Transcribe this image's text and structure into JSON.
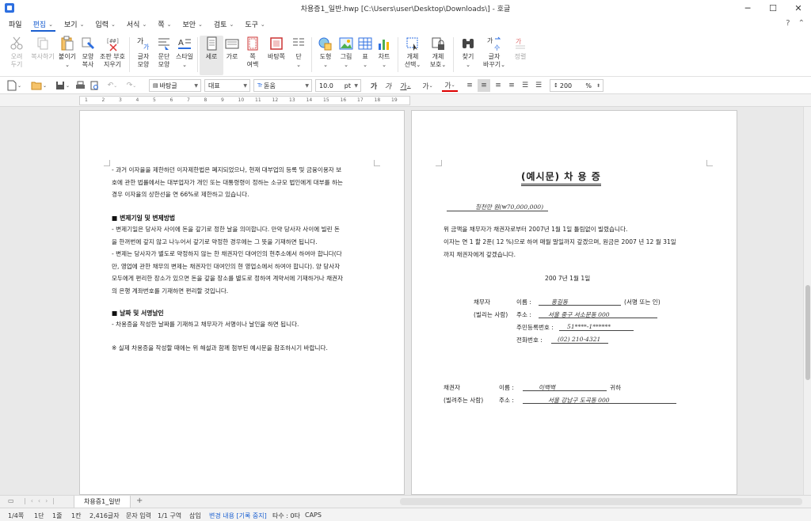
{
  "window": {
    "title": "차용증1_일반.hwp [C:\\Users\\user\\Desktop\\Downloads\\] - 호글",
    "controls": [
      "─",
      "☐",
      "✕"
    ]
  },
  "menu": [
    {
      "label": "파일",
      "caret": false
    },
    {
      "label": "편집",
      "caret": true,
      "active": true
    },
    {
      "label": "보기",
      "caret": true
    },
    {
      "label": "입력",
      "caret": true
    },
    {
      "label": "서식",
      "caret": true
    },
    {
      "label": "쪽",
      "caret": true
    },
    {
      "label": "보안",
      "caret": true
    },
    {
      "label": "검토",
      "caret": true
    },
    {
      "label": "도구",
      "caret": true
    }
  ],
  "ribbon": {
    "cut": "오려\n두기",
    "copy": "복사하기",
    "paste": "붙이기",
    "format_copy": "모양\n복사",
    "clear_format": "조판 부호\n지우기",
    "char_shape": "글자\n모양",
    "para_shape": "문단\n모양",
    "style": "스타일",
    "portrait": "세로",
    "landscape": "가로",
    "margins": "쪽\n여백",
    "page_border": "바탕쪽",
    "columns": "단",
    "shapes": "도형",
    "picture": "그림",
    "table": "표",
    "chart": "차트",
    "object_select": "개체\n선택",
    "object_protect": "개체\n보호",
    "find": "찾기",
    "replace": "글자\n바꾸기",
    "tidy": "정렬"
  },
  "format_bar": {
    "style": "바탕글",
    "lang": "대표",
    "font": "돋움",
    "size": "10.0",
    "size_unit": "pt",
    "line_spacing": "200",
    "line_spacing_unit": "%"
  },
  "ruler_numbers": [
    "1",
    "2",
    "3",
    "4",
    "5",
    "6",
    "7",
    "8",
    "9",
    "10",
    "11",
    "12",
    "13",
    "14",
    "15",
    "16",
    "17",
    "18",
    "19"
  ],
  "left_page": {
    "lines_1": [
      "- 과거 이자율을 제한하던 이자제한법은 폐지되었으나, 현재 대부업의 등록 및 금융이용자 보",
      "호에 관한 법률에서는 대부업자가 개인 또는 대통령령이 정하는 소규모 법인에게 대부를 하는",
      "경우 이자율의 상한선을 연 66%로 제한하고 있습니다."
    ],
    "head_2": "■ 변제기일 및 변제방법",
    "lines_2": [
      "- 변제기일은 당사자 사이에 돈을 갚기로 정한 날을 의미합니다. 만약 당사자 사이에 빌린 돈",
      "을 한꺼번에 갚지 않고 나누어서 갚기로 약정한 경우에는 그 뜻을 기재하면 됩니다.",
      "- 변제는 당사자가 별도로 약정하지 않는 한 채권자인 대여인의 현주소에서 하여야 합니다(다",
      "만, 영업에 관한 채무의 변제는 채권자인 대여인의 현 영업소에서 하여야 합니다). 양 당사자",
      "모두에게 편리한 장소가 있으면 돈을 갚을 장소를 별도로 정하여 계약서에 기재하거나 채권자",
      "의 은행 계좌번호를 기재하면 편리할 것입니다."
    ],
    "head_3": "■ 날짜 및 서명날인",
    "lines_3": [
      "- 차용증을 작성한 날짜를 기재하고 채무자가 서명이나 날인을 하면 됩니다."
    ],
    "note": "※ 실제 차용증을 작성할 때에는 위 해설과 함께 첨부된 예시문을 참조하시기 바랍니다."
  },
  "right_page": {
    "title": "(예시문) 차    용    증",
    "amount": "칠천만  원(₩70,000,000)",
    "body": [
      "위 금액을 채무자가 채권자로부터  2007년  1월  1일 틀림없이 빌렸습니다.",
      "이자는 연  1 할   2푼(  12 %)으로 하여 매월  말일까지 갚겠으며, 원금은  2007 년  12 월  31일",
      "까지 채권자에게 갚겠습니다."
    ],
    "date": "200 7년    1월    1일",
    "debtor": {
      "role": "채무자",
      "role_sub": "(빌리는 사람)",
      "name_label": "이름 :",
      "name_value": "홍길동",
      "name_suffix": "(서명 또는 인)",
      "addr_label": "주소 :",
      "addr_value": "서울 중구 서소문동 000",
      "id_label": "주민등록번호 :",
      "id_value": "51****-1******",
      "phone_label": "전화번호 :",
      "phone_value": "(02)  210-4321"
    },
    "creditor": {
      "role": "채권자",
      "role_sub": "(빌려주는 사람)",
      "name_label": "이름 :",
      "name_value": "이백백",
      "name_suffix": "귀하",
      "addr_label": "주소 :",
      "addr_value": "서울 강남구 도곡동 000"
    }
  },
  "tabs": {
    "doc_tab": "차용증1_일반",
    "add": "+"
  },
  "status": {
    "page": "1/4쪽",
    "column": "1단",
    "line": "1줄",
    "col": "1칸",
    "chars": "2,416글자",
    "input_mode": "문자 입력",
    "section": "1/1 구역",
    "insert": "삽입",
    "track": "변경 내용 [기록 중지]",
    "typing": "타수 : 0타",
    "caps": "CAPS"
  }
}
